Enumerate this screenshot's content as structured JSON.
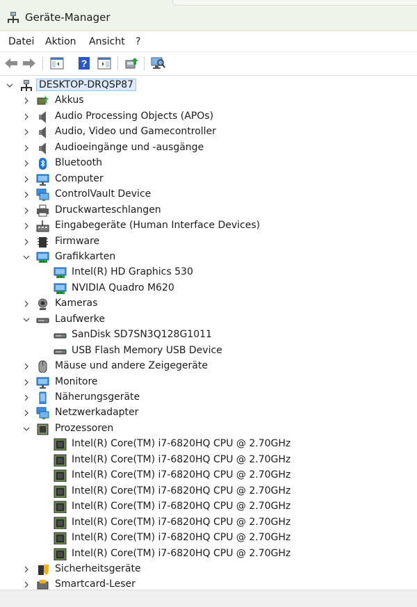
{
  "window": {
    "title": "Geräte-Manager"
  },
  "menu": {
    "items": [
      "Datei",
      "Aktion",
      "Ansicht",
      "?"
    ]
  },
  "tree": {
    "root": {
      "label": "DESKTOP-DRQSP87"
    },
    "categories": [
      {
        "label": "Akkus",
        "icon": "battery-icon"
      },
      {
        "label": "Audio Processing Objects (APOs)",
        "icon": "speaker-icon"
      },
      {
        "label": "Audio, Video und Gamecontroller",
        "icon": "speaker-icon"
      },
      {
        "label": "Audioeingänge und -ausgänge",
        "icon": "speaker-icon"
      },
      {
        "label": "Bluetooth",
        "icon": "bluetooth-icon"
      },
      {
        "label": "Computer",
        "icon": "monitor-icon"
      },
      {
        "label": "ControlVault Device",
        "icon": "network-icon"
      },
      {
        "label": "Druckwarteschlangen",
        "icon": "printer-icon"
      },
      {
        "label": "Eingabegeräte (Human Interface Devices)",
        "icon": "hid-icon"
      },
      {
        "label": "Firmware",
        "icon": "chip-icon"
      },
      {
        "label": "Grafikkarten",
        "icon": "display-adapter-icon",
        "expanded": true,
        "children": [
          "Intel(R) HD Graphics 530",
          "NVIDIA Quadro M620"
        ]
      },
      {
        "label": "Kameras",
        "icon": "camera-icon"
      },
      {
        "label": "Laufwerke",
        "icon": "drive-icon",
        "expanded": true,
        "children": [
          "SanDisk SD7SN3Q128G1011",
          "USB Flash Memory USB Device"
        ]
      },
      {
        "label": "Mäuse und andere Zeigegeräte",
        "icon": "mouse-icon"
      },
      {
        "label": "Monitore",
        "icon": "monitor-icon"
      },
      {
        "label": "Näherungsgeräte",
        "icon": "phone-icon"
      },
      {
        "label": "Netzwerkadapter",
        "icon": "network-icon"
      },
      {
        "label": "Prozessoren",
        "icon": "processor-icon",
        "expanded": true,
        "children": [
          "Intel(R) Core(TM) i7-6820HQ CPU @ 2.70GHz",
          "Intel(R) Core(TM) i7-6820HQ CPU @ 2.70GHz",
          "Intel(R) Core(TM) i7-6820HQ CPU @ 2.70GHz",
          "Intel(R) Core(TM) i7-6820HQ CPU @ 2.70GHz",
          "Intel(R) Core(TM) i7-6820HQ CPU @ 2.70GHz",
          "Intel(R) Core(TM) i7-6820HQ CPU @ 2.70GHz",
          "Intel(R) Core(TM) i7-6820HQ CPU @ 2.70GHz",
          "Intel(R) Core(TM) i7-6820HQ CPU @ 2.70GHz"
        ]
      },
      {
        "label": "Sicherheitsgeräte",
        "icon": "security-device-icon"
      },
      {
        "label": "Smartcard-Leser",
        "icon": "smartcard-reader-icon"
      }
    ]
  }
}
